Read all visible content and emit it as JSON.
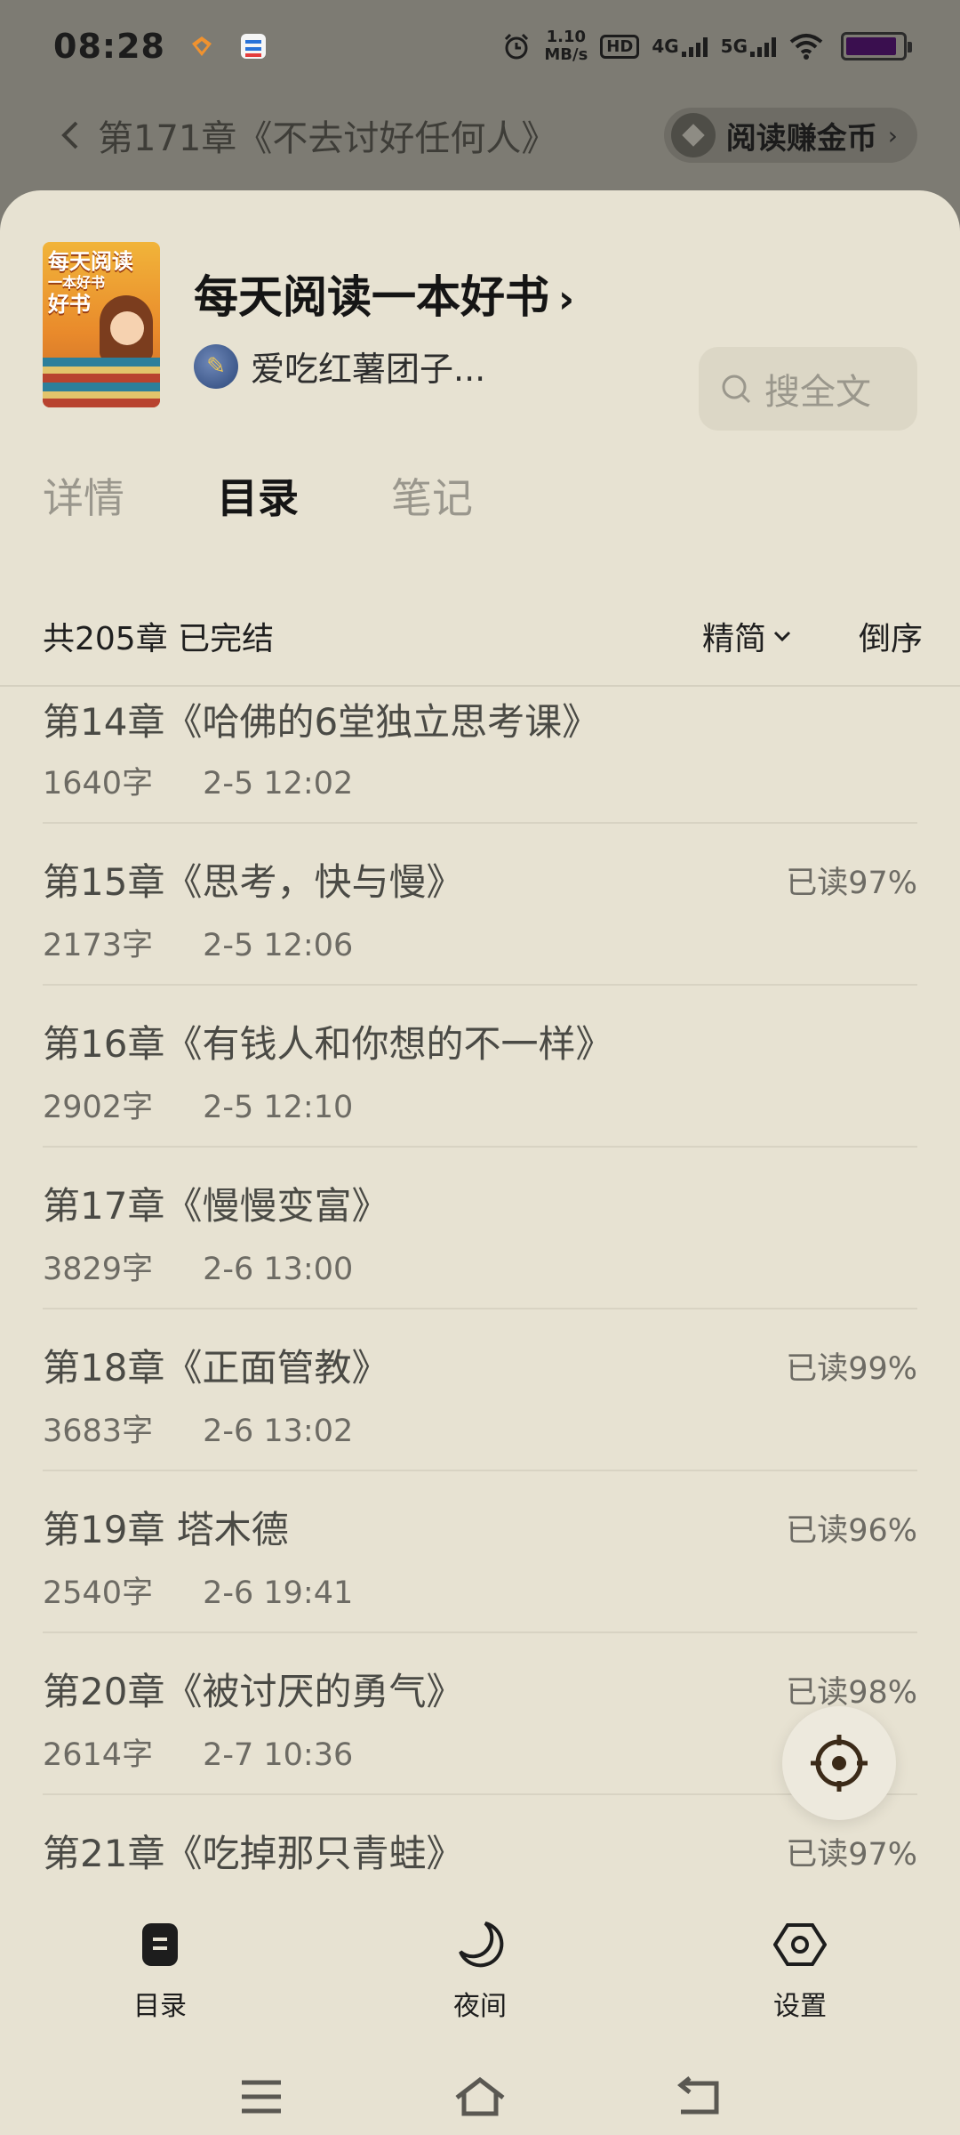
{
  "status_bar": {
    "time": "08:28",
    "net_speed_value": "1.10",
    "net_speed_unit": "MB/s",
    "hd": "HD",
    "sig4g": "4G",
    "sig5g": "5G",
    "battery_level": 0.9
  },
  "reader_bar": {
    "back_icon": "chevron-left-icon",
    "title": "第171章《不去讨好任何人》",
    "earn_label": "阅读赚金币",
    "earn_chevron": "›"
  },
  "book": {
    "cover_text_1": "每天阅读",
    "cover_text_2": "一本好书",
    "cover_text_3": "好书",
    "title": "每天阅读一本好书",
    "title_chevron": "›",
    "author": "爱吃红薯团子..."
  },
  "search": {
    "label": "搜全文"
  },
  "tabs": [
    {
      "label": "详情",
      "active": false
    },
    {
      "label": "目录",
      "active": true
    },
    {
      "label": "笔记",
      "active": false
    }
  ],
  "list_header": {
    "summary": "共205章 已完结",
    "filter": "精简",
    "order": "倒序"
  },
  "chapters": [
    {
      "title": "第14章《哈佛的6堂独立思考课》",
      "words": "1640字",
      "date": "2-5 12:02",
      "progress": ""
    },
    {
      "title": "第15章《思考，快与慢》",
      "words": "2173字",
      "date": "2-5 12:06",
      "progress": "已读97%"
    },
    {
      "title": "第16章《有钱人和你想的不一样》",
      "words": "2902字",
      "date": "2-5 12:10",
      "progress": ""
    },
    {
      "title": "第17章《慢慢变富》",
      "words": "3829字",
      "date": "2-6 13:00",
      "progress": ""
    },
    {
      "title": "第18章《正面管教》",
      "words": "3683字",
      "date": "2-6 13:02",
      "progress": "已读99%"
    },
    {
      "title": "第19章 塔木德",
      "words": "2540字",
      "date": "2-6 19:41",
      "progress": "已读96%"
    },
    {
      "title": "第20章《被讨厌的勇气》",
      "words": "2614字",
      "date": "2-7 10:36",
      "progress": "已读98%"
    },
    {
      "title": "第21章《吃掉那只青蛙》",
      "words": "",
      "date": "",
      "progress": "已读97%"
    }
  ],
  "bottom_nav": [
    {
      "label": "目录",
      "icon": "catalog-icon"
    },
    {
      "label": "夜间",
      "icon": "moon-icon"
    },
    {
      "label": "设置",
      "icon": "settings-hexagon-icon"
    }
  ],
  "colors": {
    "sheet_bg": "#e7e2d2",
    "dim_bg": "#7d7b73",
    "text_primary": "#151515",
    "text_secondary": "#6d6b64"
  }
}
